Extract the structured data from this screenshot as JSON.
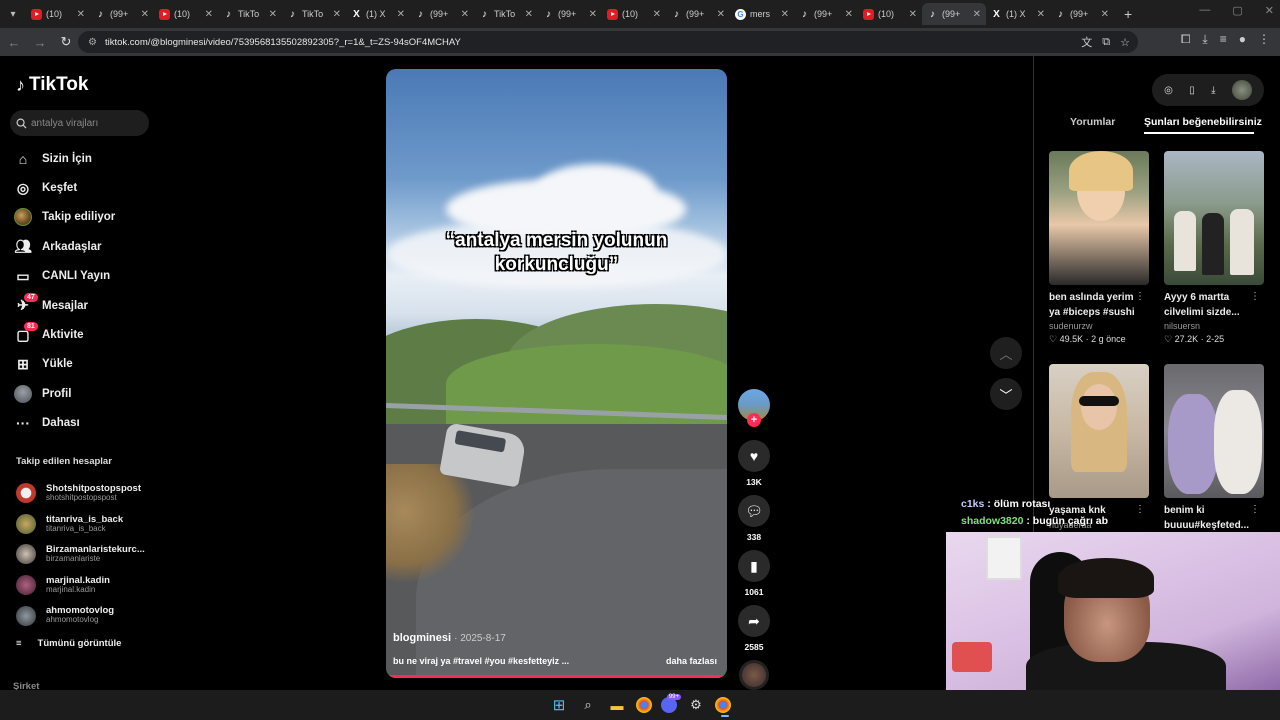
{
  "browser": {
    "tabs": [
      {
        "title": "(10)",
        "icon": "youtube-icon"
      },
      {
        "title": "(99+",
        "icon": "tiktok-icon"
      },
      {
        "title": "(10)",
        "icon": "youtube-icon"
      },
      {
        "title": "TikTo",
        "icon": "tiktok-icon"
      },
      {
        "title": "TikTo",
        "icon": "tiktok-icon"
      },
      {
        "title": "(1) X",
        "icon": "x-icon"
      },
      {
        "title": "(99+",
        "icon": "tiktok-icon"
      },
      {
        "title": "TikTo",
        "icon": "tiktok-icon"
      },
      {
        "title": "(99+",
        "icon": "tiktok-icon"
      },
      {
        "title": "(10)",
        "icon": "youtube-icon"
      },
      {
        "title": "(99+",
        "icon": "tiktok-icon"
      },
      {
        "title": "mers",
        "icon": "google-icon"
      },
      {
        "title": "(99+",
        "icon": "tiktok-icon"
      },
      {
        "title": "(10)",
        "icon": "youtube-icon"
      },
      {
        "title": "(99+",
        "icon": "tiktok-icon",
        "active": true
      },
      {
        "title": "(1) X",
        "icon": "x-icon"
      },
      {
        "title": "(99+",
        "icon": "tiktok-icon"
      }
    ],
    "url": "tiktok.com/@blogminesi/video/7539568135502892305?_r=1&_t=ZS-94sOF4MCHAY"
  },
  "sidebar": {
    "logo": "TikTok",
    "search_placeholder": "antalya virajları",
    "nav": [
      {
        "label": "Sizin İçin",
        "icon": "home-icon"
      },
      {
        "label": "Keşfet",
        "icon": "compass-icon"
      },
      {
        "label": "Takip ediliyor",
        "icon": "following-avatar-icon"
      },
      {
        "label": "Arkadaşlar",
        "icon": "friends-icon"
      },
      {
        "label": "CANLI Yayın",
        "icon": "live-icon"
      },
      {
        "label": "Mesajlar",
        "icon": "messages-icon",
        "badge": "47"
      },
      {
        "label": "Aktivite",
        "icon": "activity-icon",
        "badge": "81"
      },
      {
        "label": "Yükle",
        "icon": "upload-icon"
      },
      {
        "label": "Profil",
        "icon": "profile-avatar-icon"
      },
      {
        "label": "Dahası",
        "icon": "more-icon"
      }
    ],
    "following_header": "Takip edilen hesaplar",
    "following": [
      {
        "name": "Shotshitpostopspost",
        "handle": "shotshitpostopspost"
      },
      {
        "name": "titanriva_is_back",
        "handle": "titanriva_is_back"
      },
      {
        "name": "Birzamanlaristekurc...",
        "handle": "birzamanlariste"
      },
      {
        "name": "marjinal.kadin",
        "handle": "marjinal.kadin"
      },
      {
        "name": "ahmomotovlog",
        "handle": "ahmomotovlog"
      }
    ],
    "see_all": "Tümünü görüntüle",
    "company": "Şirket"
  },
  "video": {
    "overlay_text_1": "“antalya mersin yolunun",
    "overlay_text_2": "korkuncluğu”",
    "author": "blogminesi",
    "date": "· 2025-8-17",
    "description": "bu ne viraj ya #travel #you #kesfetteyiz ...",
    "more": "daha fazlası",
    "progress_fraction": 1.0
  },
  "actions": {
    "likes": "13K",
    "comments": "338",
    "saves": "1061",
    "shares": "2585"
  },
  "right_panel": {
    "tabs": [
      "Yorumlar",
      "Şunları beğenebilirsiniz"
    ],
    "active_tab": 1,
    "cards": [
      {
        "caption": "ben aslında yerim ya #biceps #sushi",
        "user": "sudenurzw",
        "likes": "49.5K",
        "age": "2 g önce"
      },
      {
        "caption": "Ayyy 6 martta cilvelimi sizde...",
        "user": "nilsuersn",
        "likes": "27.2K",
        "age": "2-25"
      },
      {
        "caption": "yaşama knk",
        "user": "nuyaderaa",
        "likes": "",
        "age": ""
      },
      {
        "caption": "benim ki buuuu#keşfeted...",
        "user": "",
        "likes": "",
        "age": ""
      }
    ]
  },
  "chat": [
    {
      "user": "c1ks",
      "message": "ölüm rotası"
    },
    {
      "user": "shadow3820",
      "message": "bugün çağrı ab"
    }
  ],
  "taskbar": {
    "discord_badge": "99+"
  },
  "colors": {
    "accent": "#fe2c55",
    "background": "#000000"
  }
}
